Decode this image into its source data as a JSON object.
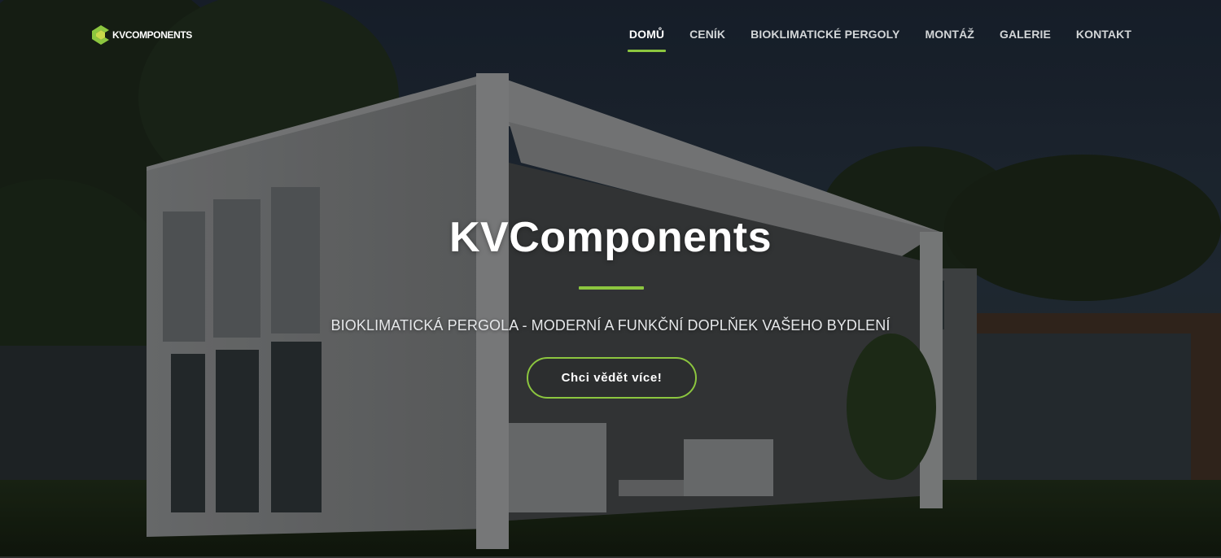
{
  "brand": {
    "logo_text": "KVCOMPONENTS",
    "accent_color": "#8cc63f"
  },
  "nav": {
    "items": [
      {
        "label": "DOMŮ",
        "active": true
      },
      {
        "label": "CENÍK",
        "active": false
      },
      {
        "label": "BIOKLIMATICKÉ PERGOLY",
        "active": false
      },
      {
        "label": "MONTÁŽ",
        "active": false
      },
      {
        "label": "GALERIE",
        "active": false
      },
      {
        "label": "KONTAKT",
        "active": false
      }
    ]
  },
  "hero": {
    "title": "KVComponents",
    "subtitle": "BIOKLIMATICKÁ PERGOLA - MODERNÍ A FUNKČNÍ DOPLŇEK VAŠEHO BYDLENÍ",
    "cta_label": "Chci vědět více!",
    "background": "pergola-house-night-photo"
  }
}
